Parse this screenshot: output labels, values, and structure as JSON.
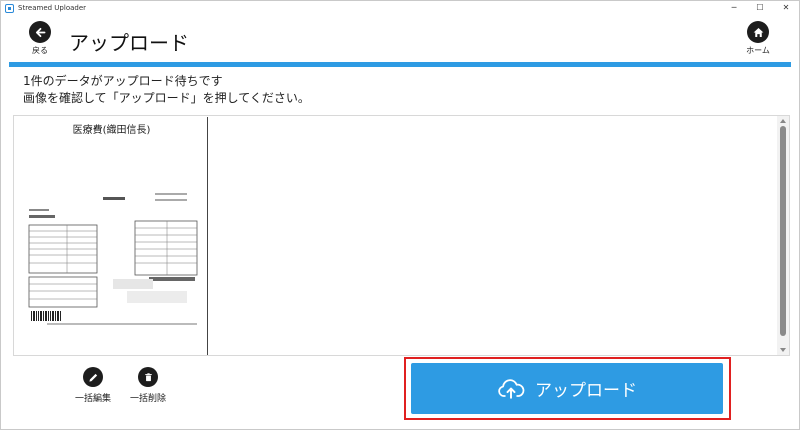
{
  "window": {
    "title": "Streamed Uploader",
    "controls": {
      "minimize": "─",
      "maximize": "☐",
      "close": "✕"
    }
  },
  "header": {
    "back_label": "戻る",
    "title": "アップロード",
    "home_label": "ホーム"
  },
  "status": {
    "line1": "1件のデータがアップロード待ちです",
    "line2": "画像を確認して「アップロード」を押してください。"
  },
  "preview": {
    "items": [
      {
        "title": "医療費(織田信長)"
      }
    ]
  },
  "toolbar": {
    "bulk_edit_label": "一括編集",
    "bulk_delete_label": "一括削除",
    "upload_label": "アップロード"
  },
  "icons": {
    "back": "arrow-left-icon",
    "home": "home-icon",
    "edit": "pencil-icon",
    "delete": "trash-icon",
    "upload": "cloud-upload-icon"
  },
  "colors": {
    "accent": "#2e9be3",
    "highlight": "#e02020",
    "icon_bg": "#1d1d1d"
  }
}
